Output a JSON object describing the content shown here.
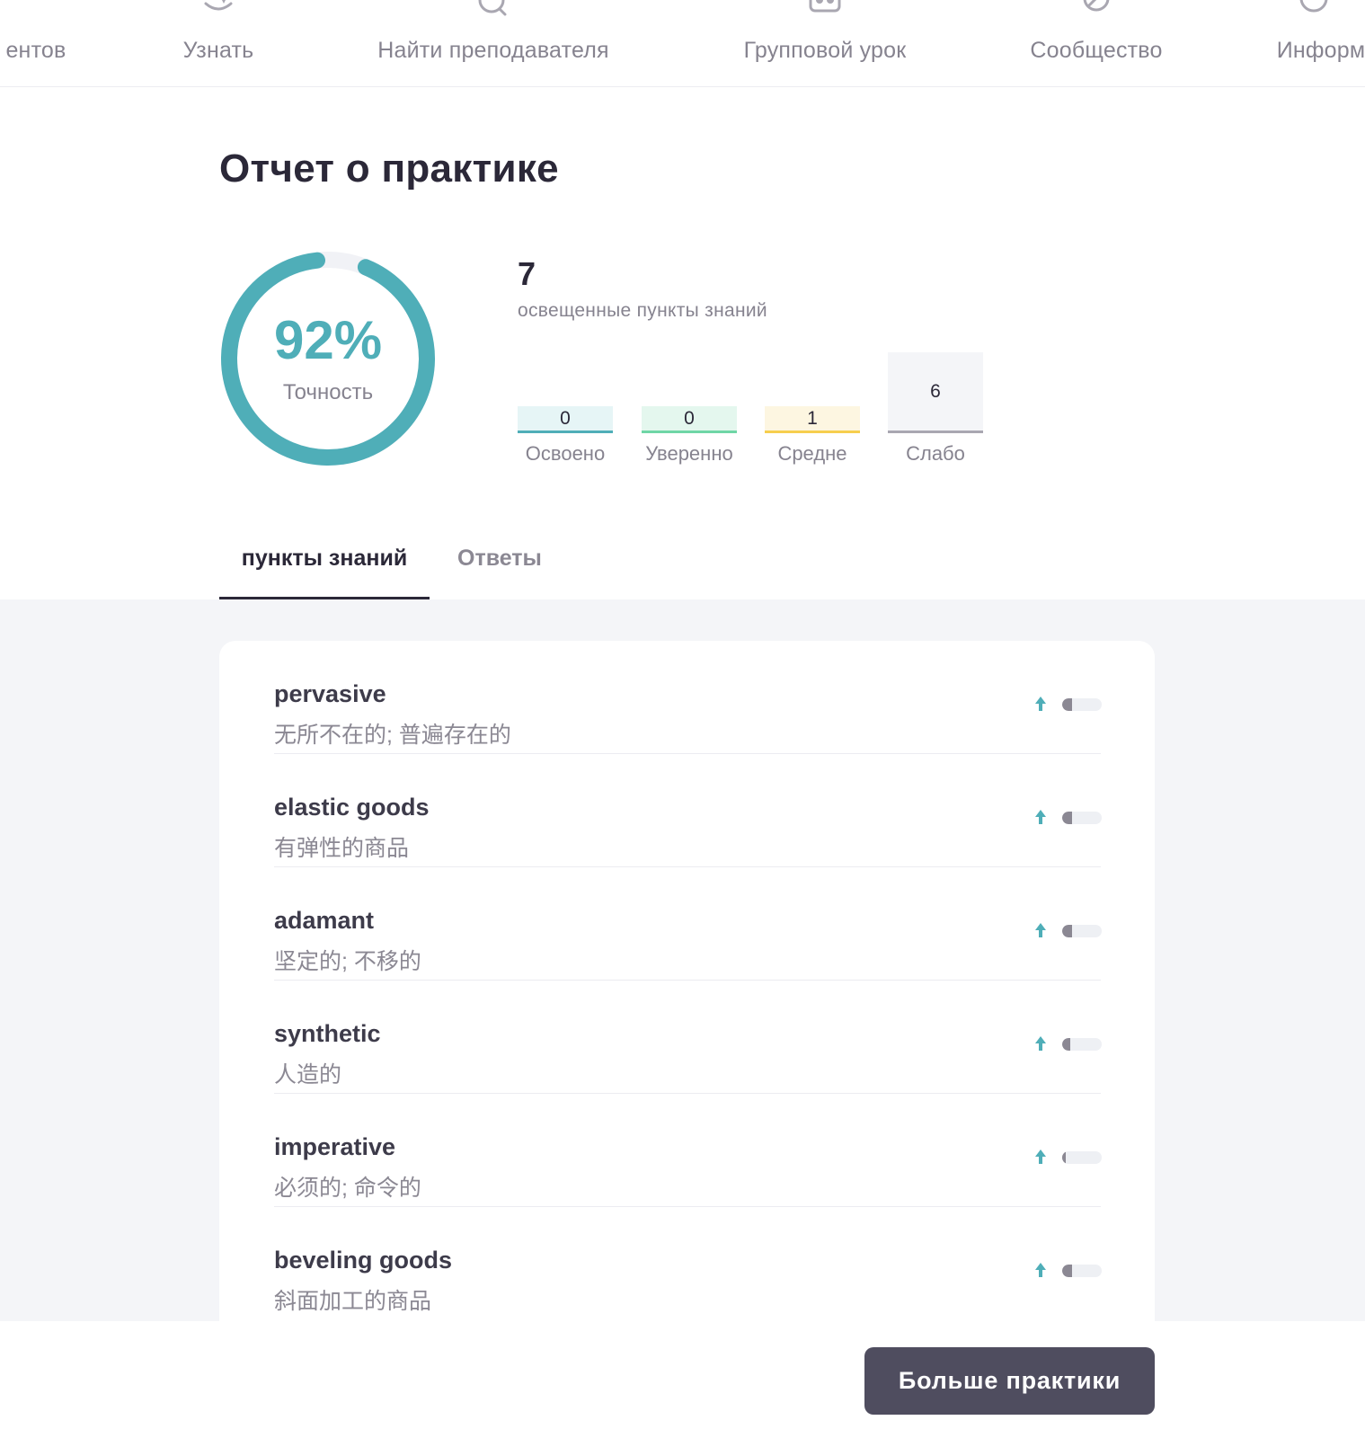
{
  "nav": {
    "items": [
      {
        "label": "ентов",
        "icon": "students-icon"
      },
      {
        "label": "Узнать",
        "icon": "learn-icon"
      },
      {
        "label": "Найти преподавателя",
        "icon": "search-icon"
      },
      {
        "label": "Групповой урок",
        "icon": "group-class-icon"
      },
      {
        "label": "Сообщество",
        "icon": "community-icon"
      },
      {
        "label": "Информ",
        "icon": "more-icon"
      }
    ]
  },
  "report": {
    "title": "Отчет о практике",
    "accuracy": {
      "value": "92%",
      "fraction": 0.92,
      "label": "Точность"
    },
    "knowledge_points": {
      "count": "7",
      "label": "освещенные пункты знаний"
    },
    "levels": [
      {
        "value": "0",
        "label": "Освоено",
        "bg": "#e6f5f6",
        "line": "#4faeb8"
      },
      {
        "value": "0",
        "label": "Уверенно",
        "bg": "#e4f7ee",
        "line": "#6fd6a6"
      },
      {
        "value": "1",
        "label": "Средне",
        "bg": "#fdf6e1",
        "line": "#f6ce4e"
      },
      {
        "value": "6",
        "label": "Слабо",
        "bg": "#f4f5f8",
        "line": "#a9a7b1"
      }
    ]
  },
  "tabs": {
    "active": "пункты знаний",
    "inactive": "Ответы"
  },
  "items": [
    {
      "word": "pervasive",
      "translation": "无所不在的; 普遍存在的",
      "progress": 0.25
    },
    {
      "word": "elastic goods",
      "translation": "有弹性的商品",
      "progress": 0.25
    },
    {
      "word": "adamant",
      "translation": "坚定的; 不移的",
      "progress": 0.25
    },
    {
      "word": "synthetic",
      "translation": "人造的",
      "progress": 0.2
    },
    {
      "word": "imperative",
      "translation": "必须的; 命令的",
      "progress": 0.1
    },
    {
      "word": "beveling goods",
      "translation": "斜面加工的商品",
      "progress": 0.25
    }
  ],
  "actions": {
    "more_practice": "Больше практики"
  },
  "colors": {
    "accent": "#4faeb8",
    "dark": "#2b2838",
    "muted": "#86838f",
    "button": "#4f4d5f"
  }
}
